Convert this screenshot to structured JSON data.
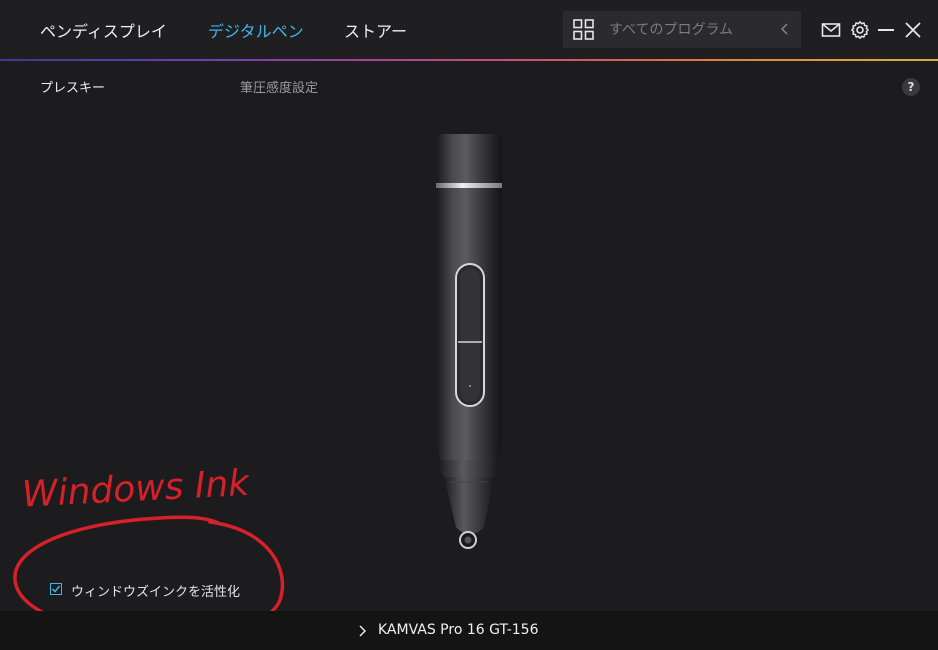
{
  "nav": {
    "tabs": [
      {
        "label": "ペンディスプレイ",
        "active": false
      },
      {
        "label": "デジタルペン",
        "active": true
      },
      {
        "label": "ストアー",
        "active": false
      }
    ]
  },
  "search": {
    "placeholder": "すべてのプログラム",
    "icon": "grid-icon"
  },
  "header_icons": [
    "grid-icon",
    "chevron-left-icon",
    "mail-icon",
    "gear-icon",
    "minimize-icon",
    "close-icon"
  ],
  "subtabs": [
    {
      "label": "プレスキー",
      "active": true
    },
    {
      "label": "筆圧感度設定",
      "active": false
    }
  ],
  "help": {
    "label": "?"
  },
  "windows_ink": {
    "label": "ウィンドウズインクを活性化",
    "checked": true,
    "annotation": "Windows Ink"
  },
  "device": {
    "name": "KAMVAS Pro 16 GT-156"
  },
  "colors": {
    "accent": "#3fb6e6",
    "background": "#1c1c1e",
    "annotation": "#d6202a"
  }
}
